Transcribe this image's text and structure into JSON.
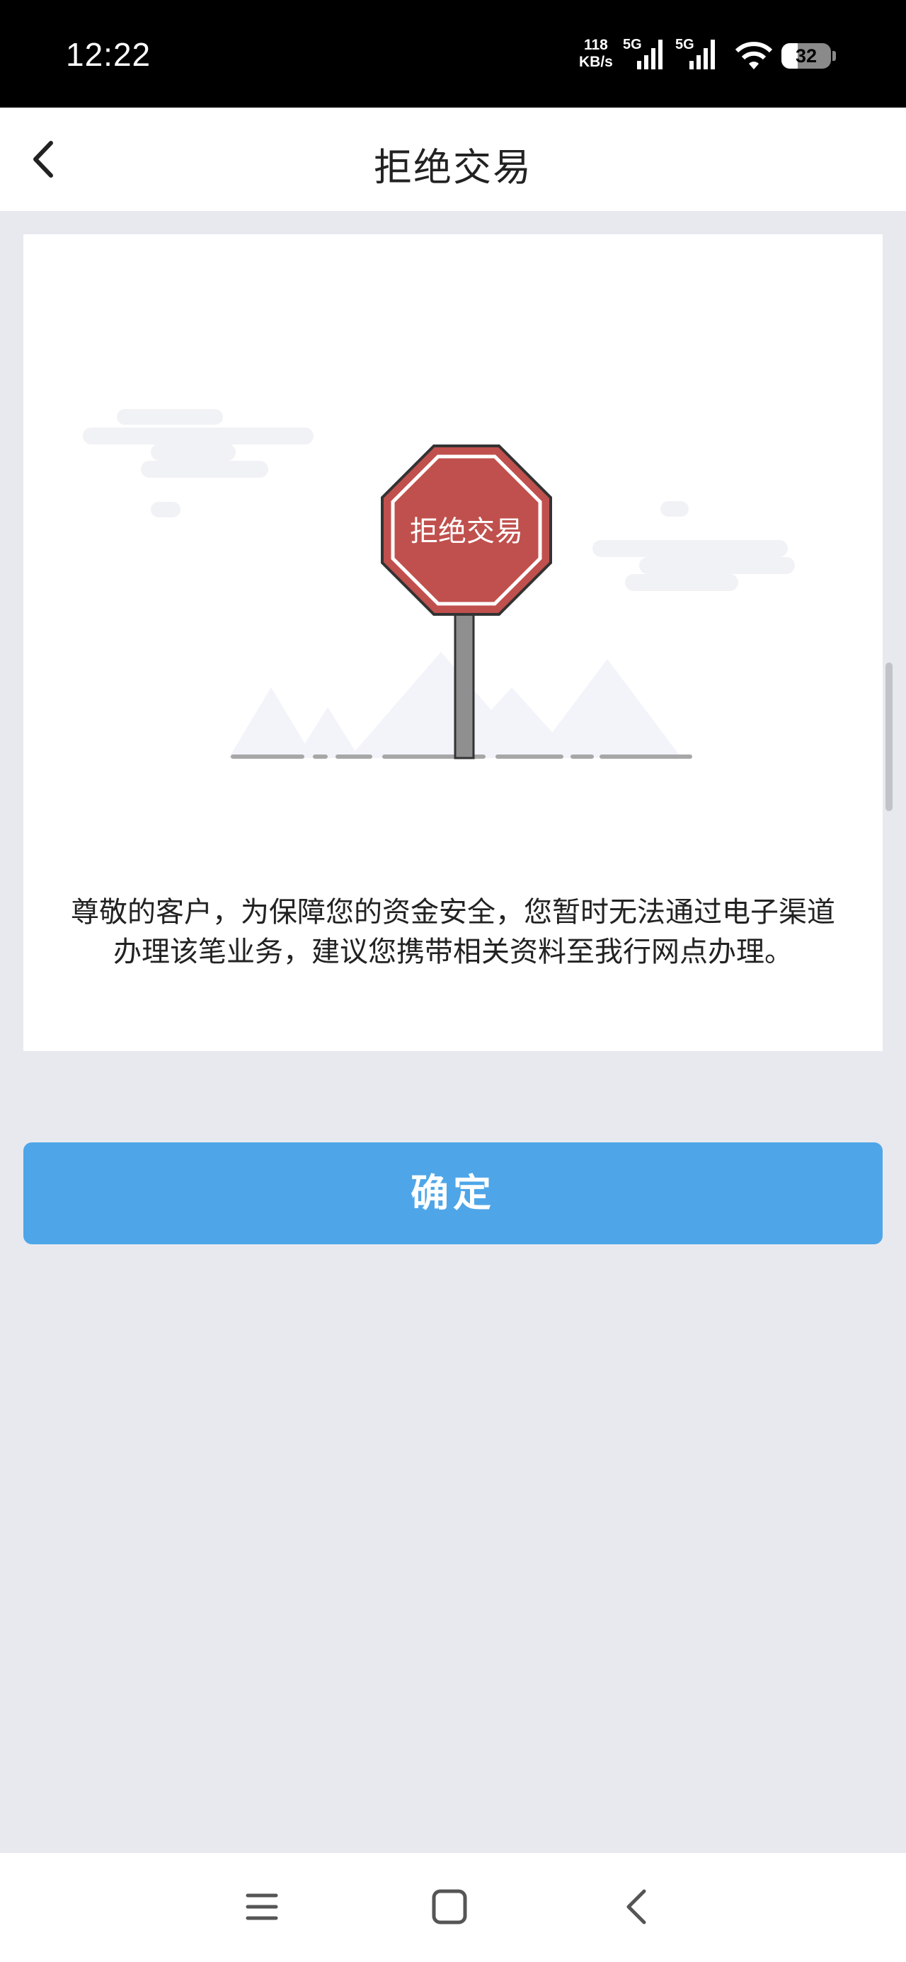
{
  "status_bar": {
    "time": "12:22",
    "net_speed_value": "118",
    "net_speed_unit": "KB/s",
    "signal1_label": "5G",
    "signal2_label": "5G",
    "battery": "32"
  },
  "header": {
    "title": "拒绝交易"
  },
  "illustration": {
    "sign_text": "拒绝交易",
    "sign_color": "#c0504d"
  },
  "message": "尊敬的客户，为保障您的资金安全，您暂时无法通过电子渠道办理该笔业务，建议您携带相关资料至我行网点办理。",
  "confirm_button": {
    "label": "确定",
    "color": "#4ea6e8"
  },
  "system_nav": {
    "icons": [
      "menu-icon",
      "home-icon",
      "back-icon"
    ]
  }
}
